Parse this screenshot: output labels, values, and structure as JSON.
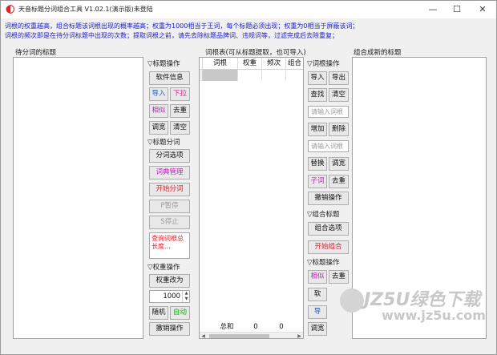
{
  "window": {
    "title": "天音标题分词组合工具 V1.02.1(演示版)未登陆",
    "min_glyph": "—",
    "max_glyph": "☐",
    "close_glyph": "✕"
  },
  "info": {
    "line1": "词根的权重越高，组合标题该词根出现的概率越高；权重为1000相当于王词，每个标题必须出现；权重为0相当于屏蔽该词；",
    "line2": "词根的频次即是在待分词标题中出现的次数；提取词根之前，请先去除标题品牌词、违规词等，过滤完成后去除重复；"
  },
  "left_label": "待分词的标题",
  "grid_label": "词根表(可从标题提取，也可导入)",
  "right_label": "组合成新的标题",
  "col1": {
    "section_title": "▽标题操作",
    "software_info": "软件信息",
    "import": "导入",
    "dropdown": "下拉",
    "similar": "相似",
    "dedupe": "去重",
    "adjust_width": "调宽",
    "clear": "清空",
    "segment_title": "▽标题分词",
    "segment_options": "分词选项",
    "dict_manage": "词典管理",
    "start_segment": "开始分词",
    "pause": "P暂停",
    "stop": "S停止",
    "query_text": "查询词根总长度...",
    "weight_title": "▽权重操作",
    "weight_change": "权重改为",
    "weight_value": "1000",
    "random": "随机",
    "auto": "自动",
    "undo": "撤销操作"
  },
  "grid": {
    "headers": [
      "词根",
      "权重",
      "频次",
      "组合"
    ],
    "footer_label": "总和",
    "footer_weight": "0",
    "footer_freq": "0"
  },
  "col2": {
    "section_title": "▽词根操作",
    "import": "导入",
    "export": "导出",
    "find": "查找",
    "clear": "清空",
    "input_placeholder": "请输入词根",
    "add": "增加",
    "delete": "删除",
    "replace": "替换",
    "adjust_width": "调宽",
    "sub_word": "子词",
    "dedupe": "去重",
    "undo": "撤销操作",
    "combine_title": "▽组合标题",
    "combine_options": "组合选项",
    "start_combine": "开始组合",
    "title_op": "▽标题操作",
    "similar": "相似",
    "dedupe2": "去重",
    "soft": "软",
    "import2": "导",
    "adjust": "调宽"
  },
  "watermark": {
    "main": "JZ5U绿色下载",
    "url": "www.jz5u.com"
  },
  "colors": {
    "info_text": "#1a1ad0",
    "red": "#e0202e",
    "blue": "#1560d8",
    "purple": "#c020c0",
    "green": "#17a017"
  }
}
